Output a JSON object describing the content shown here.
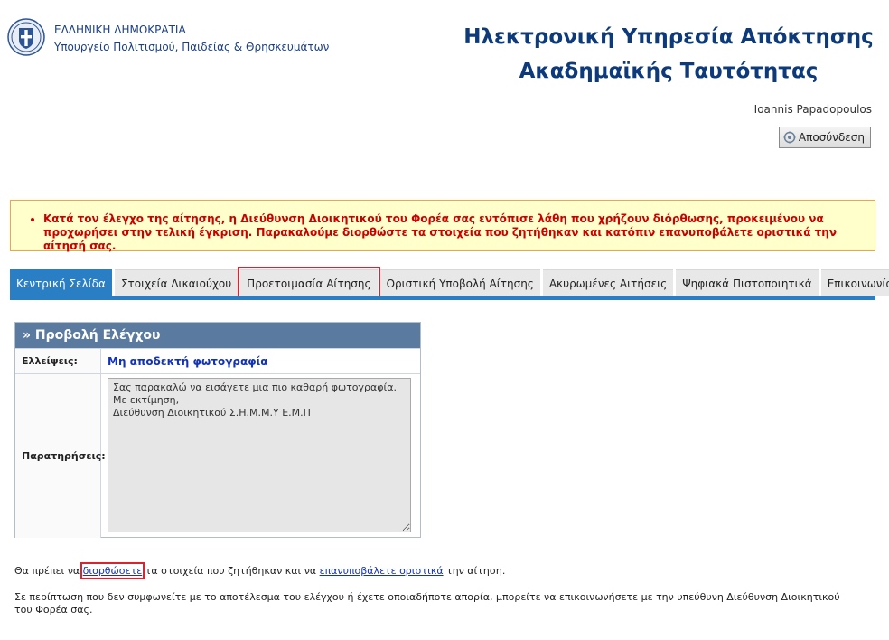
{
  "header": {
    "ministry_line1": "ΕΛΛΗΝΙΚΗ ΔΗΜΟΚΡΑΤΙΑ",
    "ministry_line2": "Υπουργείο Πολιτισμού, Παιδείας & Θρησκευμάτων",
    "service_title_line1": "Ηλεκτρονική Υπηρεσία Απόκτησης",
    "service_title_line2": "Ακαδημαϊκής Ταυτότητας",
    "username": "Ioannis Papadopoulos",
    "logout_label": "Αποσύνδεση"
  },
  "warning": {
    "message": "Κατά τον έλεγχο της αίτησης, η Διεύθυνση Διοικητικού του Φορέα σας εντόπισε λάθη που χρήζουν διόρθωσης, προκειμένου να προχωρήσει στην τελική έγκριση. Παρακαλούμε διορθώστε τα στοιχεία που ζητήθηκαν και κατόπιν επανυποβάλετε οριστικά την αίτησή σας."
  },
  "tabs": [
    {
      "label": "Κεντρική Σελίδα"
    },
    {
      "label": "Στοιχεία Δικαιούχου"
    },
    {
      "label": "Προετοιμασία Αίτησης"
    },
    {
      "label": "Οριστική Υποβολή Αίτησης"
    },
    {
      "label": "Ακυρωμένες Αιτήσεις"
    },
    {
      "label": "Ψηφιακά Πιστοποιητικά"
    },
    {
      "label": "Επικοινωνία"
    }
  ],
  "panel": {
    "title": "» Προβολή Ελέγχου",
    "deficiencies_label": "Ελλείψεις:",
    "deficiencies_value": "Μη αποδεκτή φωτογραφία",
    "remarks_label": "Παρατηρήσεις:",
    "remarks_value": "Σας παρακαλώ να εισάγετε μια πιο καθαρή φωτογραφία.\nΜε εκτίμηση,\nΔιεύθυνση Διοικητικού Σ.Η.Μ.Μ.Υ Ε.Μ.Π"
  },
  "instructions": {
    "part1": "Θα πρέπει να ",
    "link_fix": "διορθώσετε",
    "part2": " τα στοιχεία που ζητήθηκαν και να ",
    "link_resubmit": "επανυποβάλετε οριστικά",
    "part3": " την αίτηση."
  },
  "note": "Σε περίπτωση που δεν συμφωνείτε με το αποτέλεσμα του ελέγχου ή έχετε οποιαδήποτε απορία, μπορείτε να επικοινωνήσετε με την υπεύθυνη Διεύθυνση Διοικητικού του Φορέα σας.",
  "colors": {
    "accent": "#2a7fc4",
    "title_blue": "#0d3a7a",
    "warning_text": "#cc0000",
    "highlight_red": "#d9232e"
  },
  "icons": {
    "logo": "greek-coat-of-arms-icon",
    "logout": "logout-icon"
  }
}
